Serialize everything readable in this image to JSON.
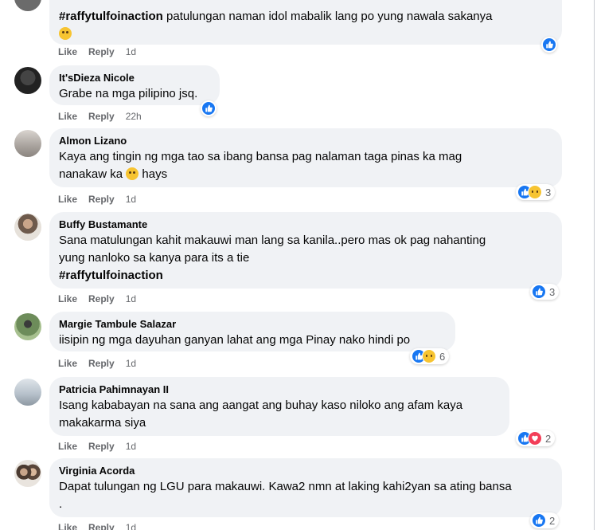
{
  "comments": [
    {
      "author": "",
      "hashtag": "#raffytulfoinaction",
      "text": " patulungan naman idol mabalik lang po yung nawala sakanya",
      "emoji": "sad-emoji",
      "like_label": "Like",
      "reply_label": "Reply",
      "time": "1d",
      "reactions": [
        "like"
      ],
      "reaction_count": ""
    },
    {
      "author": "It'sDieza Nicole",
      "text": "Grabe na mga pilipino jsq.",
      "like_label": "Like",
      "reply_label": "Reply",
      "time": "22h",
      "reactions": [
        "like"
      ],
      "reaction_count": ""
    },
    {
      "author": "Almon Lizano",
      "text_line1": "Kaya ang tingin ng mga tao sa ibang bansa pag nalaman taga pinas ka mag",
      "text_line2a": "nanakaw ka ",
      "text_line2b": " hays",
      "like_label": "Like",
      "reply_label": "Reply",
      "time": "1d",
      "reactions": [
        "like",
        "sad"
      ],
      "reaction_count": "3"
    },
    {
      "author": "Buffy Bustamante",
      "text_line1": "Sana matulungan kahit makauwi man lang sa kanila..pero mas ok pag nahanting",
      "text_line2": "yung nanloko sa kanya para its a tie",
      "hashtag": "#raffytulfoinaction",
      "like_label": "Like",
      "reply_label": "Reply",
      "time": "1d",
      "reactions": [
        "like"
      ],
      "reaction_count": "3"
    },
    {
      "author": "Margie Tambule Salazar",
      "text": "iisipin ng mga dayuhan ganyan lahat ang mga Pinay nako hindi po",
      "like_label": "Like",
      "reply_label": "Reply",
      "time": "1d",
      "reactions": [
        "like",
        "sad"
      ],
      "reaction_count": "6"
    },
    {
      "author": "Patricia Pahimnayan II",
      "text_line1": "Isang kababayan na sana ang aangat ang buhay kaso niloko ang afam kaya",
      "text_line2": "makakarma siya",
      "like_label": "Like",
      "reply_label": "Reply",
      "time": "1d",
      "reactions": [
        "like",
        "care"
      ],
      "reaction_count": "2"
    },
    {
      "author": "Virginia Acorda",
      "text_line1": "Dapat tulungan ng LGU para makauwi. Kawa2 nmn at laking kahi2yan sa ating bansa",
      "text_line2": ".",
      "like_label": "Like",
      "reply_label": "Reply",
      "time": "1d",
      "reactions": [
        "like"
      ],
      "reaction_count": "2"
    }
  ],
  "colors": {
    "bubble": "#f0f2f5",
    "like_blue": "#1877f2",
    "meta_gray": "#65676b"
  }
}
